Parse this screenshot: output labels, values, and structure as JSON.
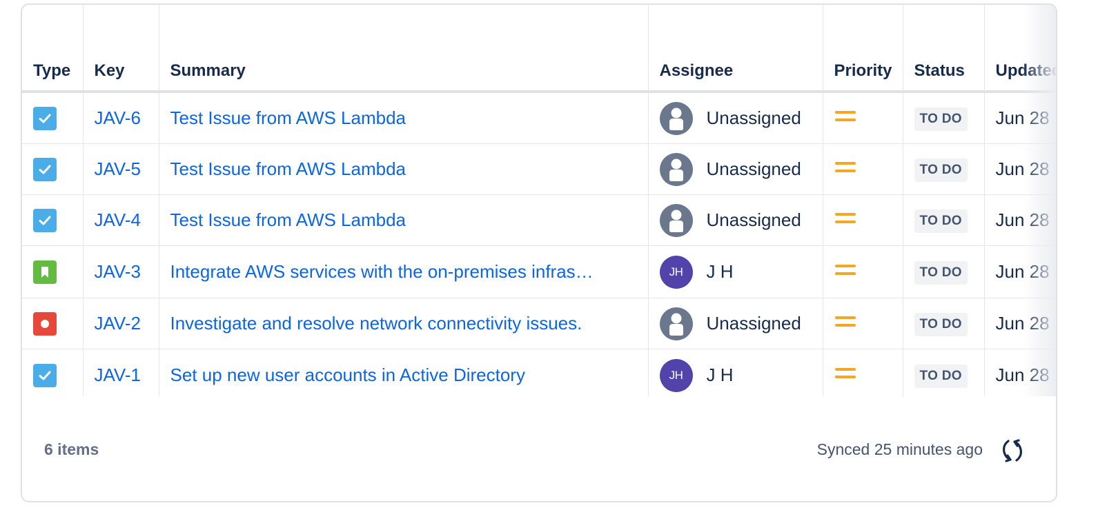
{
  "columns": {
    "type": "Type",
    "key": "Key",
    "summary": "Summary",
    "assignee": "Assignee",
    "priority": "Priority",
    "status": "Status",
    "updated": "Updated"
  },
  "rows": [
    {
      "type_icon": "task-checkbox-icon",
      "key": "JAV-6",
      "summary": "Test Issue from AWS Lambda",
      "assignee": "Unassigned",
      "avatar_initials": "",
      "priority_icon": "priority-medium-icon",
      "status": "TO DO",
      "updated": "Jun 28"
    },
    {
      "type_icon": "task-checkbox-icon",
      "key": "JAV-5",
      "summary": "Test Issue from AWS Lambda",
      "assignee": "Unassigned",
      "avatar_initials": "",
      "priority_icon": "priority-medium-icon",
      "status": "TO DO",
      "updated": "Jun 28"
    },
    {
      "type_icon": "task-checkbox-icon",
      "key": "JAV-4",
      "summary": "Test Issue from AWS Lambda",
      "assignee": "Unassigned",
      "avatar_initials": "",
      "priority_icon": "priority-medium-icon",
      "status": "TO DO",
      "updated": "Jun 28"
    },
    {
      "type_icon": "story-bookmark-icon",
      "key": "JAV-3",
      "summary": "Integrate AWS services with the on-premises infras…",
      "assignee": "J H",
      "avatar_initials": "JH",
      "priority_icon": "priority-medium-icon",
      "status": "TO DO",
      "updated": "Jun 28"
    },
    {
      "type_icon": "bug-dot-icon",
      "key": "JAV-2",
      "summary": "Investigate and resolve network connectivity issues.",
      "assignee": "Unassigned",
      "avatar_initials": "",
      "priority_icon": "priority-medium-icon",
      "status": "TO DO",
      "updated": "Jun 28"
    },
    {
      "type_icon": "task-checkbox-icon",
      "key": "JAV-1",
      "summary": "Set up new user accounts in Active Directory",
      "assignee": "J H",
      "avatar_initials": "JH",
      "priority_icon": "priority-medium-icon",
      "status": "TO DO",
      "updated": "Jun 28"
    }
  ],
  "footer": {
    "count": "6 items",
    "sync_status": "Synced 25 minutes ago",
    "refresh_icon": "refresh-icon"
  },
  "colors": {
    "link": "#0c66e4",
    "task": "#4bade8",
    "story": "#65ba43",
    "bug": "#e5493a",
    "priority_medium": "#f5a623",
    "avatar_jh": "#5243aa",
    "avatar_default": "#6b778c"
  }
}
